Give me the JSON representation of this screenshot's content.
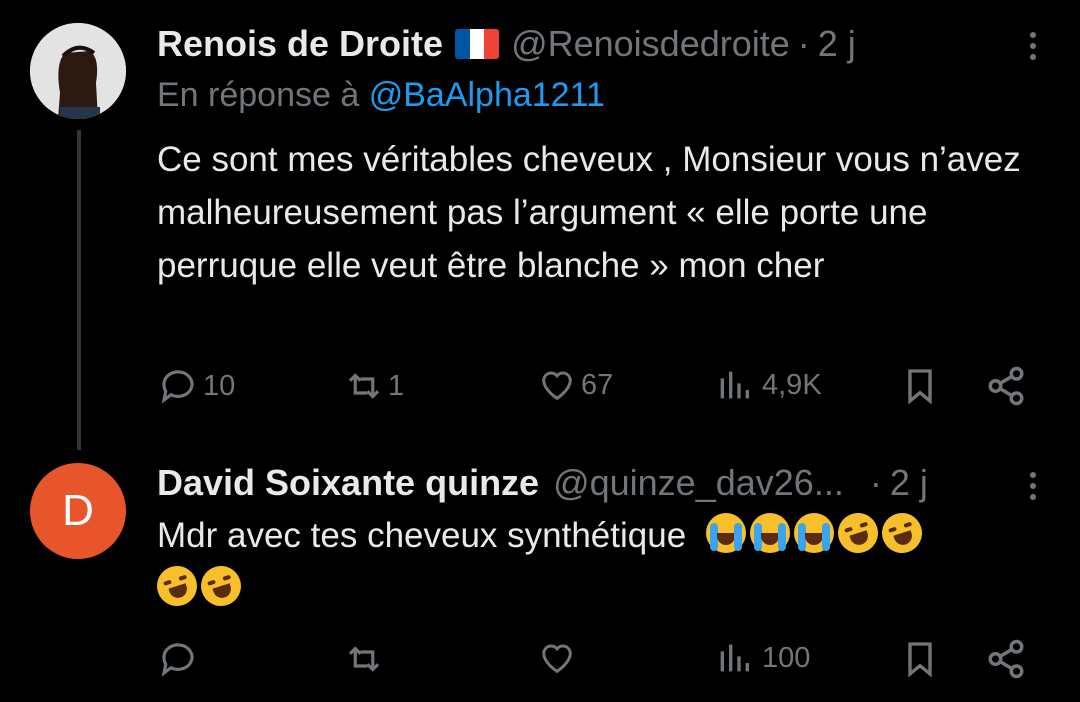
{
  "tweet1": {
    "name": "Renois de Droite",
    "handle": "@Renoisdedroite",
    "dot": "·",
    "time": "2 j",
    "reply_prefix": "En réponse à ",
    "reply_mention": "@BaAlpha1211",
    "text": "Ce sont mes véritables cheveux , Monsieur vous n’avez malheureusement pas l’argument «  elle porte une perruque elle veut être blanche » mon cher",
    "stats": {
      "replies": "10",
      "reposts": "1",
      "likes": "67",
      "views": "4,9K"
    },
    "flag_colors": [
      "#0055a4",
      "#ffffff",
      "#ef4135"
    ]
  },
  "tweet2": {
    "avatar_letter": "D",
    "avatar_color": "#e8552b",
    "name": "David Soixante quinze",
    "handle": "@quinze_dav26...",
    "dot": "·",
    "time": "2 j",
    "text": "Mdr avec tes cheveux synthétique",
    "emojis": [
      "loudly-crying-face",
      "loudly-crying-face",
      "loudly-crying-face",
      "rolling-laughing-face",
      "rolling-laughing-face",
      "rolling-laughing-face",
      "rolling-laughing-face"
    ],
    "stats": {
      "views": "100"
    }
  }
}
